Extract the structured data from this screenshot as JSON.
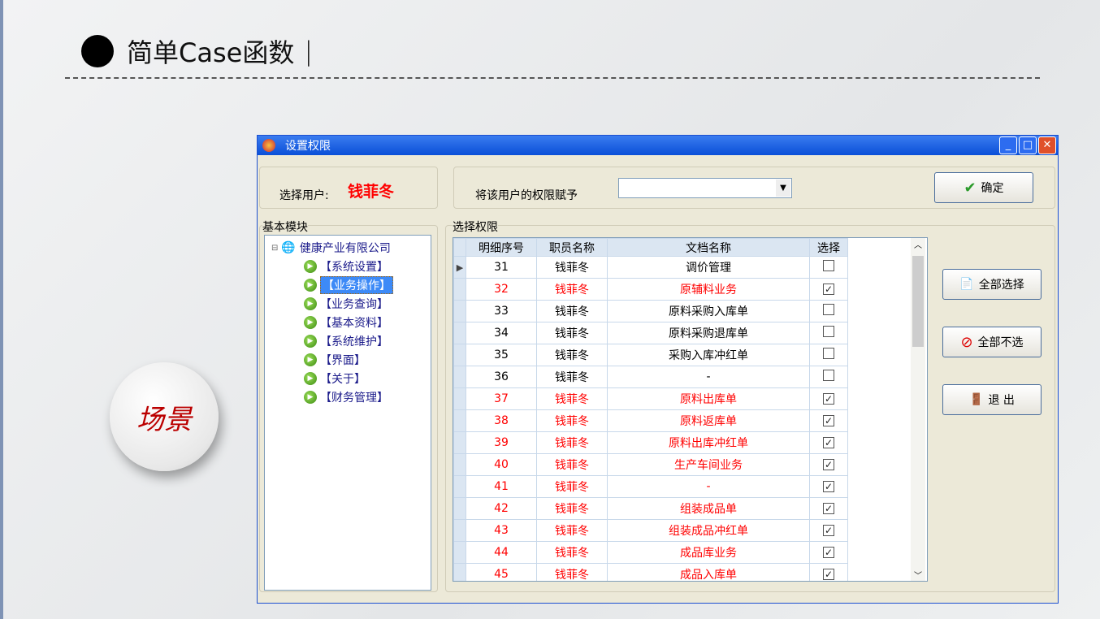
{
  "slide": {
    "title": "简单Case函数",
    "cursor": "|",
    "scene_label": "场景"
  },
  "window": {
    "title": "设置权限"
  },
  "user": {
    "label": "选择用户:",
    "name": "钱菲冬"
  },
  "assign": {
    "label": "将该用户的权限赋予",
    "value": ""
  },
  "buttons": {
    "ok": "确定",
    "select_all": "全部选择",
    "select_none": "全部不选",
    "exit": "退 出"
  },
  "tree": {
    "label": "基本模块",
    "root": "健康产业有限公司",
    "items": [
      "【系统设置】",
      "【业务操作】",
      "【业务查询】",
      "【基本资料】",
      "【系统维护】",
      "【界面】",
      "【关于】",
      "【财务管理】"
    ],
    "selected": 1
  },
  "grid": {
    "label": "选择权限",
    "columns": [
      "明细序号",
      "职员名称",
      "文档名称",
      "选择"
    ],
    "rows": [
      [
        "31",
        "钱菲冬",
        "调价管理",
        false
      ],
      [
        "32",
        "钱菲冬",
        "原辅料业务",
        true
      ],
      [
        "33",
        "钱菲冬",
        "原料采购入库单",
        false
      ],
      [
        "34",
        "钱菲冬",
        "原料采购退库单",
        false
      ],
      [
        "35",
        "钱菲冬",
        "采购入库冲红单",
        false
      ],
      [
        "36",
        "钱菲冬",
        "-",
        false
      ],
      [
        "37",
        "钱菲冬",
        "原料出库单",
        true
      ],
      [
        "38",
        "钱菲冬",
        "原料返库单",
        true
      ],
      [
        "39",
        "钱菲冬",
        "原料出库冲红单",
        true
      ],
      [
        "40",
        "钱菲冬",
        "生产车间业务",
        true
      ],
      [
        "41",
        "钱菲冬",
        "-",
        true
      ],
      [
        "42",
        "钱菲冬",
        "组装成品单",
        true
      ],
      [
        "43",
        "钱菲冬",
        "组装成品冲红单",
        true
      ],
      [
        "44",
        "钱菲冬",
        "成品库业务",
        true
      ],
      [
        "45",
        "钱菲冬",
        "成品入库单",
        true
      ]
    ]
  },
  "colors": {
    "accent_red": "#ff0000",
    "tree_text": "#1a1a8a",
    "titlebar": "#0a4fd8"
  }
}
